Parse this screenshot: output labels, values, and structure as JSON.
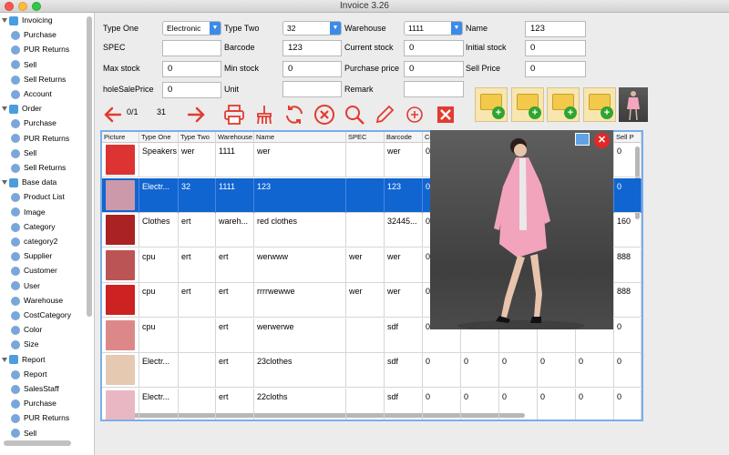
{
  "window": {
    "title": "Invoice 3.26"
  },
  "sidebar": {
    "groups": [
      {
        "label": "Invoicing",
        "items": [
          "Purchase",
          "PUR Returns",
          "Sell",
          "Sell Returns",
          "Account"
        ]
      },
      {
        "label": "Order",
        "items": [
          "Purchase",
          "PUR Returns",
          "Sell",
          "Sell Returns"
        ]
      },
      {
        "label": "Base data",
        "items": [
          "Product List",
          "Image",
          "Category",
          "category2",
          "Supplier",
          "Customer",
          "User",
          "Warehouse",
          "CostCategory",
          "Color",
          "Size"
        ]
      },
      {
        "label": "Report",
        "items": [
          "Report",
          "SalesStaff",
          "Purchase",
          "PUR Returns",
          "Sell"
        ]
      }
    ]
  },
  "form": {
    "type_one_label": "Type One",
    "type_one_value": "Electronic",
    "type_two_label": "Type Two",
    "type_two_value": "32",
    "warehouse_label": "Warehouse",
    "warehouse_value": "1111",
    "name_label": "Name",
    "name_value": "123",
    "spec_label": "SPEC",
    "spec_value": "",
    "barcode_label": "Barcode",
    "barcode_value": "123",
    "current_stock_label": "Current stock",
    "current_stock_value": "0",
    "initial_stock_label": "Initial stock",
    "initial_stock_value": "0",
    "max_stock_label": "Max stock",
    "max_stock_value": "0",
    "min_stock_label": "Min stock",
    "min_stock_value": "0",
    "purchase_price_label": "Purchase price",
    "purchase_price_value": "0",
    "sell_price_label": "Sell Price",
    "sell_price_value": "0",
    "wholesale_label": "holeSalePrice",
    "wholesale_value": "0",
    "unit_label": "Unit",
    "unit_value": "",
    "remark_label": "Remark",
    "remark_value": ""
  },
  "toolbar": {
    "page_indicator": "0/1",
    "record_count": "31"
  },
  "table": {
    "columns": [
      "Picture",
      "Type One",
      "Type Two",
      "Warehouse",
      "Name",
      "SPEC",
      "Barcode",
      "Co",
      "",
      "",
      "",
      "",
      "Sell P"
    ],
    "rows": [
      {
        "type_one": "Speakers",
        "type_two": "wer",
        "warehouse": "1111",
        "name": "wer",
        "spec": "",
        "barcode": "wer",
        "c7": "0",
        "c8": "",
        "c9": "",
        "c10": "",
        "c11": "",
        "sell": "0",
        "thumb": "#d33"
      },
      {
        "type_one": "Electr...",
        "type_two": "32",
        "warehouse": "1111",
        "name": "123",
        "spec": "",
        "barcode": "123",
        "c7": "0",
        "c8": "",
        "c9": "",
        "c10": "",
        "c11": "",
        "sell": "0",
        "thumb": "#c9a"
      },
      {
        "type_one": "Clothes",
        "type_two": "ert",
        "warehouse": "wareh...",
        "name": "red clothes",
        "spec": "",
        "barcode": "32445...",
        "c7": "0",
        "c8": "",
        "c9": "",
        "c10": "",
        "c11": "",
        "sell": "160",
        "thumb": "#a22"
      },
      {
        "type_one": "cpu",
        "type_two": "ert",
        "warehouse": "ert",
        "name": "werwww",
        "spec": "wer",
        "barcode": "wer",
        "c7": "0",
        "c8": "",
        "c9": "",
        "c10": "",
        "c11": "",
        "sell": "888",
        "thumb": "#b55"
      },
      {
        "type_one": "cpu",
        "type_two": "ert",
        "warehouse": "ert",
        "name": "rrrrwewwe",
        "spec": "wer",
        "barcode": "wer",
        "c7": "0",
        "c8": "",
        "c9": "",
        "c10": "",
        "c11": "",
        "sell": "888",
        "thumb": "#c22"
      },
      {
        "type_one": "cpu",
        "type_two": "",
        "warehouse": "ert",
        "name": "werwerwe",
        "spec": "",
        "barcode": "sdf",
        "c7": "0",
        "c8": "",
        "c9": "",
        "c10": "",
        "c11": "",
        "sell": "0",
        "thumb": "#d88"
      },
      {
        "type_one": "Electr...",
        "type_two": "",
        "warehouse": "ert",
        "name": "23clothes",
        "spec": "",
        "barcode": "sdf",
        "c7": "0",
        "c8": "0",
        "c9": "0",
        "c10": "0",
        "c11": "0",
        "sell": "0",
        "thumb": "#e5c9b0"
      },
      {
        "type_one": "Electr...",
        "type_two": "",
        "warehouse": "ert",
        "name": "22cloths",
        "spec": "",
        "barcode": "sdf",
        "c7": "0",
        "c8": "0",
        "c9": "0",
        "c10": "0",
        "c11": "0",
        "sell": "0",
        "thumb": "#e9b7c4"
      }
    ]
  }
}
